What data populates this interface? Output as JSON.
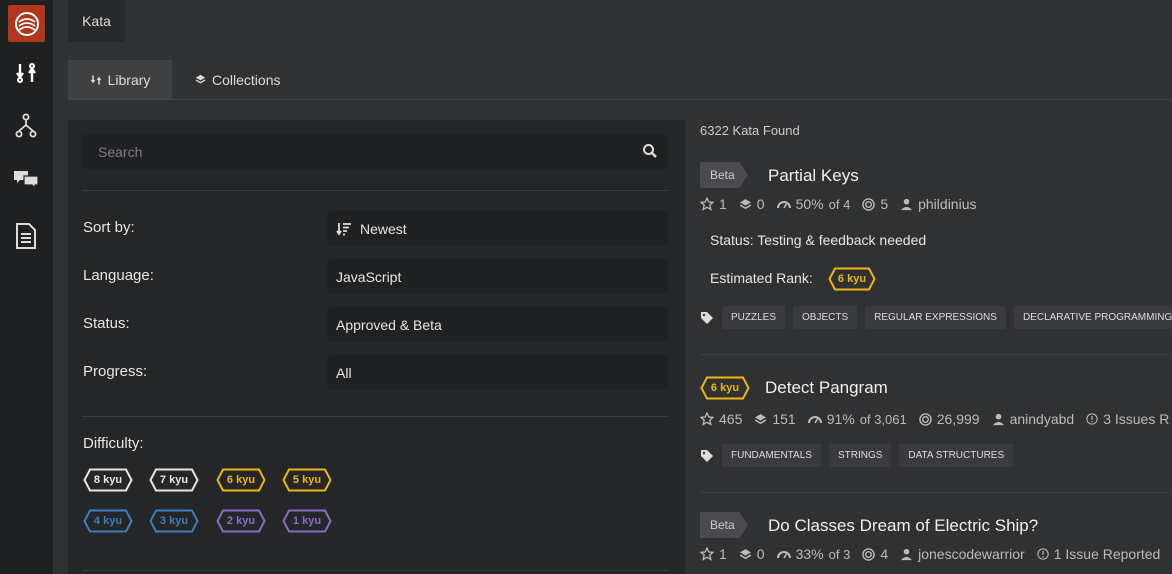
{
  "colors": {
    "kyu_white": "#e6e6e6",
    "kyu_yellow": "#ecb613",
    "kyu_blue": "#3c7ebb",
    "kyu_purple": "#866cc7",
    "brand": "#b1361e"
  },
  "sidebar": {
    "icons": [
      "codewars-logo-icon",
      "practice-icon",
      "fork-icon",
      "discuss-icon",
      "docs-icon"
    ]
  },
  "top_tab": "Kata",
  "tabs": {
    "library": "Library",
    "collections": "Collections"
  },
  "filters": {
    "search_placeholder": "Search",
    "sort": {
      "label": "Sort by:",
      "value": "Newest"
    },
    "language": {
      "label": "Language:",
      "value": "JavaScript"
    },
    "status": {
      "label": "Status:",
      "value": "Approved & Beta"
    },
    "progress": {
      "label": "Progress:",
      "value": "All"
    },
    "difficulty": {
      "label": "Difficulty:",
      "kyus": [
        "8 kyu",
        "7 kyu",
        "6 kyu",
        "5 kyu",
        "4 kyu",
        "3 kyu",
        "2 kyu",
        "1 kyu"
      ]
    }
  },
  "results": {
    "found": "6322 Kata Found",
    "katas": [
      {
        "badge": "Beta",
        "title": "Partial Keys",
        "stars": "1",
        "collections": "0",
        "satisfaction": "50%",
        "votes": "of 4",
        "completed": "5",
        "author": "phildinius",
        "status_label": "Status:",
        "status_value": "Testing & feedback needed",
        "rank_label": "Estimated Rank:",
        "rank": "6 kyu",
        "tags": [
          "PUZZLES",
          "OBJECTS",
          "REGULAR EXPRESSIONS",
          "DECLARATIVE PROGRAMMING"
        ]
      },
      {
        "rank": "6 kyu",
        "title": "Detect Pangram",
        "stars": "465",
        "collections": "151",
        "satisfaction": "91%",
        "votes": "of 3,061",
        "completed": "26,999",
        "author": "anindyabd",
        "issues": "3 Issues R",
        "tags": [
          "FUNDAMENTALS",
          "STRINGS",
          "DATA STRUCTURES"
        ]
      },
      {
        "badge": "Beta",
        "title": "Do Classes Dream of Electric Ship?",
        "stars": "1",
        "collections": "0",
        "satisfaction": "33%",
        "votes": "of 3",
        "completed": "4",
        "author": "jonescodewarrior",
        "issues": "1 Issue Reported"
      }
    ]
  }
}
